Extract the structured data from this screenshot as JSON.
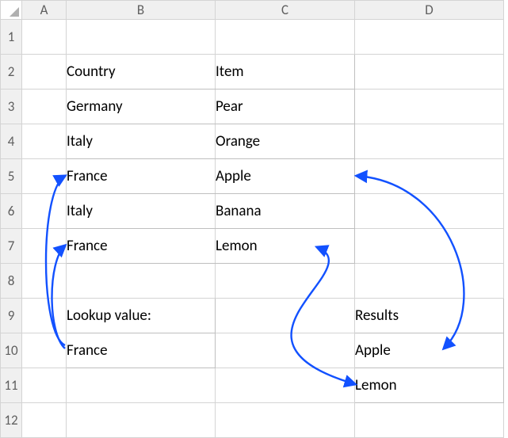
{
  "columns": {
    "A": "A",
    "B": "B",
    "C": "C",
    "D": "D"
  },
  "rows": [
    "1",
    "2",
    "3",
    "4",
    "5",
    "6",
    "7",
    "8",
    "9",
    "10",
    "11",
    "12"
  ],
  "table1": {
    "headers": {
      "country": "Country",
      "item": "Item"
    },
    "rows": [
      {
        "country": "Germany",
        "item": "Pear"
      },
      {
        "country": "Italy",
        "item": "Orange"
      },
      {
        "country": "France",
        "item": "Apple"
      },
      {
        "country": "Italy",
        "item": "Banana"
      },
      {
        "country": "France",
        "item": "Lemon"
      }
    ]
  },
  "lookup": {
    "label": "Lookup value:",
    "value": "France"
  },
  "results": {
    "header": "Results",
    "values": [
      "Apple",
      "Lemon"
    ]
  },
  "arrow_color": "#1251ff"
}
